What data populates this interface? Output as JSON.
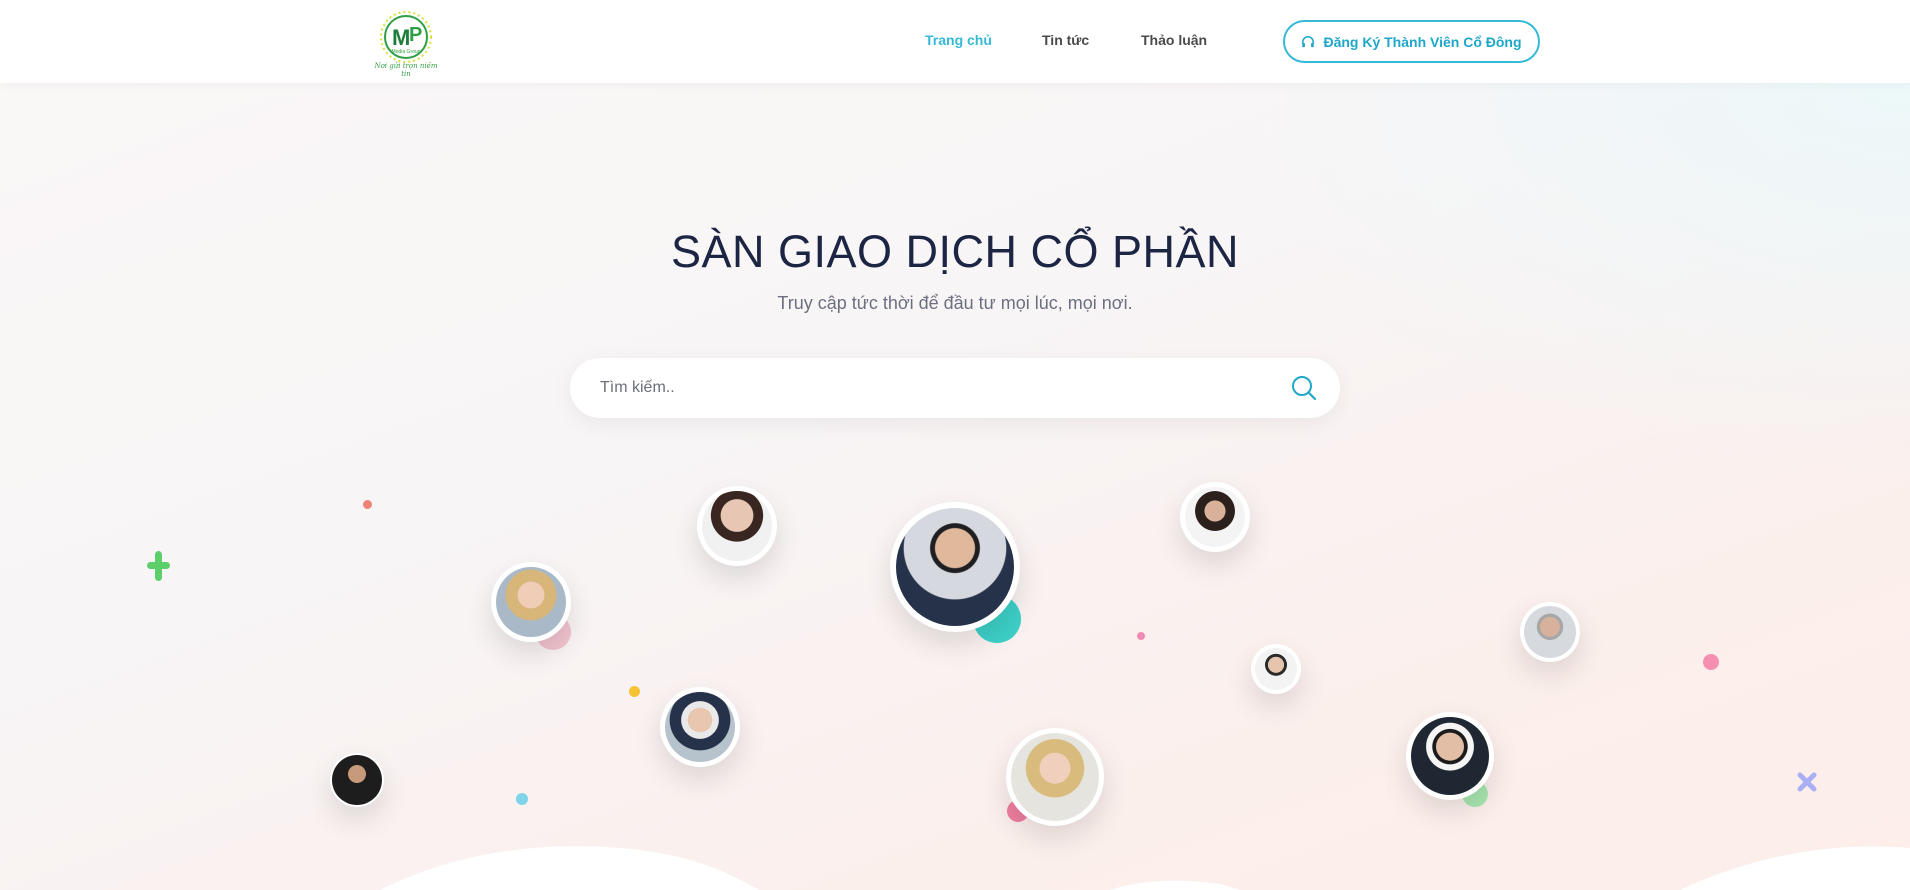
{
  "header": {
    "logo": {
      "letters": "MP",
      "small_text": "Media Group",
      "tagline": "Nơi gửi trọn niềm tin",
      "brand_color": "#2ea043"
    },
    "nav": [
      {
        "label": "Trang chủ",
        "active": true
      },
      {
        "label": "Tin tức",
        "active": false
      },
      {
        "label": "Thảo luận",
        "active": false
      }
    ],
    "cta_label": "Đăng Ký Thành Viên Cổ Đông",
    "cta_icon": "headphones-icon"
  },
  "hero": {
    "title": "SÀN GIAO DỊCH CỔ PHẦN",
    "subtitle": "Truy cập tức thời để đầu tư mọi lúc, mọi nơi.",
    "search_placeholder": "Tìm kiếm..",
    "search_icon": "search-icon"
  },
  "colors": {
    "accent": "#36b9d8",
    "title": "#1c2543",
    "teal_dot": "#3dd0c8",
    "green_plus": "#5ccf6a",
    "pink_dot": "#f07fa0"
  }
}
